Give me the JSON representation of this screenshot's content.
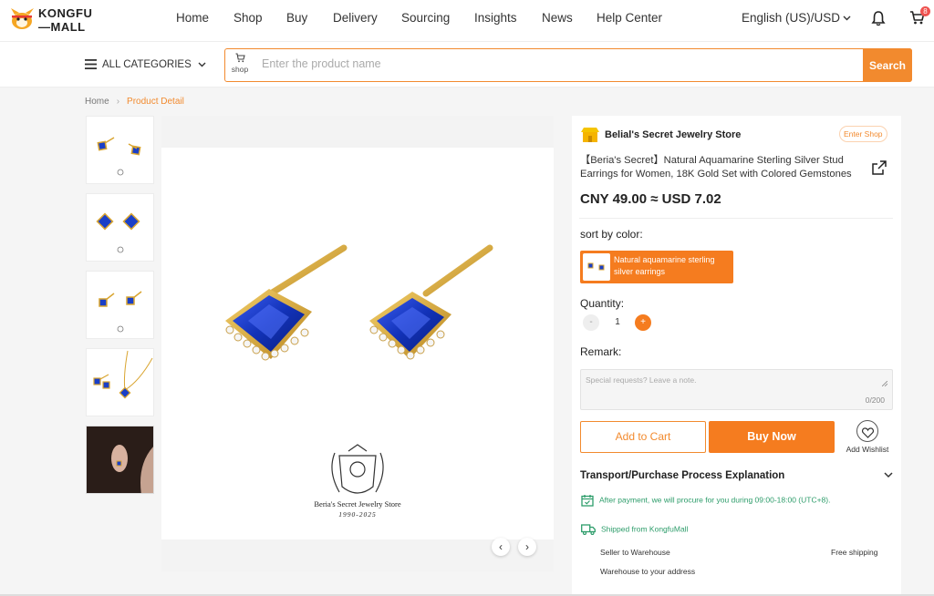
{
  "header": {
    "logo_line1": "KONGFU",
    "logo_line2": "MALL",
    "nav": [
      "Home",
      "Shop",
      "Buy",
      "Delivery",
      "Sourcing",
      "Insights",
      "News",
      "Help Center"
    ],
    "language": "English (US)/USD",
    "cart_count": "8"
  },
  "search": {
    "categories_label": "ALL CATEGORIES",
    "shop_label": "shop",
    "placeholder": "Enter the product name",
    "button": "Search"
  },
  "breadcrumb": {
    "home": "Home",
    "current": "Product Detail"
  },
  "product": {
    "store_name": "Belial's Secret Jewelry Store",
    "enter_shop": "Enter Shop",
    "title": "【Beria's Secret】Natural Aquamarine Sterling Silver Stud Earrings for Women, 18K Gold Set with Colored Gemstones",
    "price": "CNY 49.00 ≈  USD 7.02",
    "sort_label": "sort by color:",
    "variant": "Natural aquamarine sterling silver earrings",
    "quantity_label": "Quantity:",
    "quantity": "1",
    "remark_label": "Remark:",
    "remark_placeholder": "Special requests? Leave a note.",
    "remark_count": "0/200",
    "add_to_cart": "Add to Cart",
    "buy_now": "Buy Now",
    "add_wishlist": "Add Wishlist",
    "brand_watermark": "Beria's Secret Jewelry Store",
    "brand_years": "1990-2025"
  },
  "transport": {
    "title": "Transport/Purchase Process Explanation",
    "procure_note": "After payment, we will procure for you during 09:00-18:00 (UTC+8).",
    "shipped_from": "Shipped from KongfuMall",
    "seller_to_warehouse": "Seller to Warehouse",
    "free_shipping": "Free shipping",
    "warehouse_to_address": "Warehouse to your address"
  },
  "colors": {
    "accent": "#f28a2e",
    "accent_dark": "#f57c1f",
    "green": "#2e9d6b",
    "sapphire": "#1a3fc7",
    "gold": "#d9a531"
  }
}
